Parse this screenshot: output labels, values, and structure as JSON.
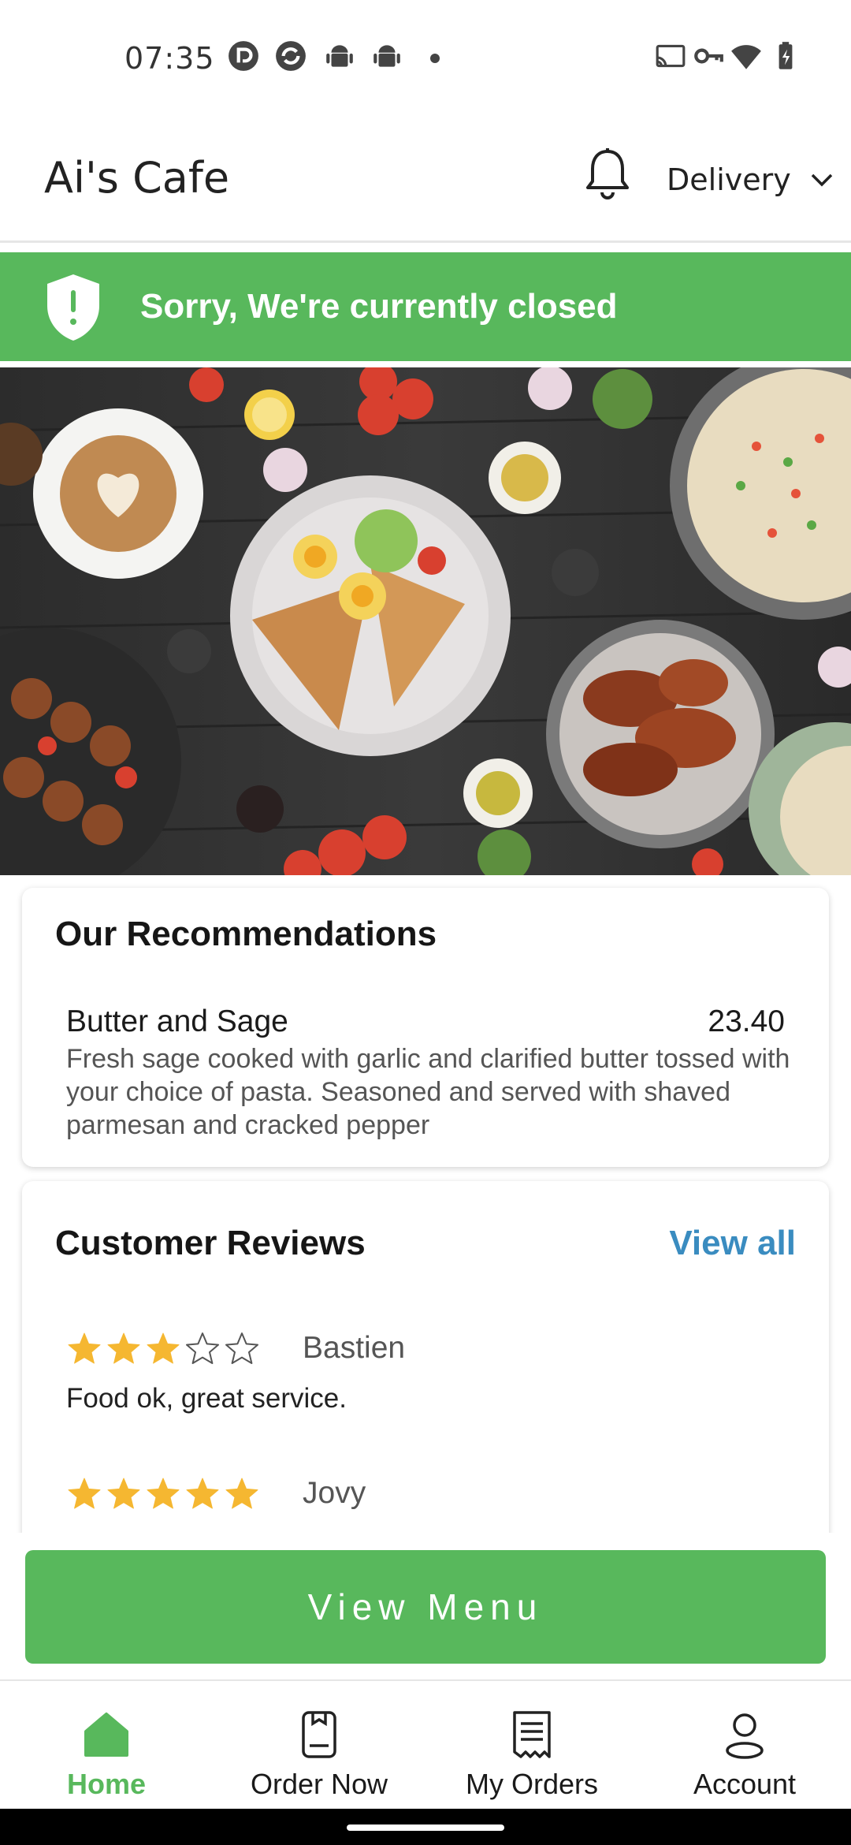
{
  "status_bar": {
    "time": "07:35",
    "icons": [
      "pocketcasts-icon",
      "sync-icon",
      "android-icon",
      "android-icon",
      "cast-icon",
      "vpn-key-icon",
      "wifi-icon",
      "battery-charging-icon"
    ]
  },
  "header": {
    "title": "Ai's Cafe",
    "delivery_label": "Delivery"
  },
  "banner": {
    "message": "Sorry, We're currently closed",
    "color": "#58b85c"
  },
  "recommendations": {
    "title": "Our Recommendations",
    "items": [
      {
        "name": "Butter and Sage",
        "price": "23.40",
        "description": "Fresh sage cooked with garlic and clarified butter tossed with your choice of pasta. Seasoned and served with shaved parmesan and cracked pepper"
      }
    ]
  },
  "reviews": {
    "title": "Customer Reviews",
    "view_all_label": "View all",
    "items": [
      {
        "name": "Bastien",
        "rating": 3,
        "max_rating": 5,
        "text": "Food ok, great service."
      },
      {
        "name": "Jovy",
        "rating": 5,
        "max_rating": 5,
        "text": ""
      }
    ]
  },
  "view_menu_label": "View Menu",
  "bottom_nav": {
    "items": [
      {
        "label": "Home",
        "icon": "home-icon",
        "active": true
      },
      {
        "label": "Order Now",
        "icon": "order-now-icon",
        "active": false
      },
      {
        "label": "My Orders",
        "icon": "receipt-icon",
        "active": false
      },
      {
        "label": "Account",
        "icon": "account-icon",
        "active": false
      }
    ]
  },
  "colors": {
    "accent": "#58b85c",
    "link": "#3a8cc0",
    "star": "#f5b731"
  }
}
